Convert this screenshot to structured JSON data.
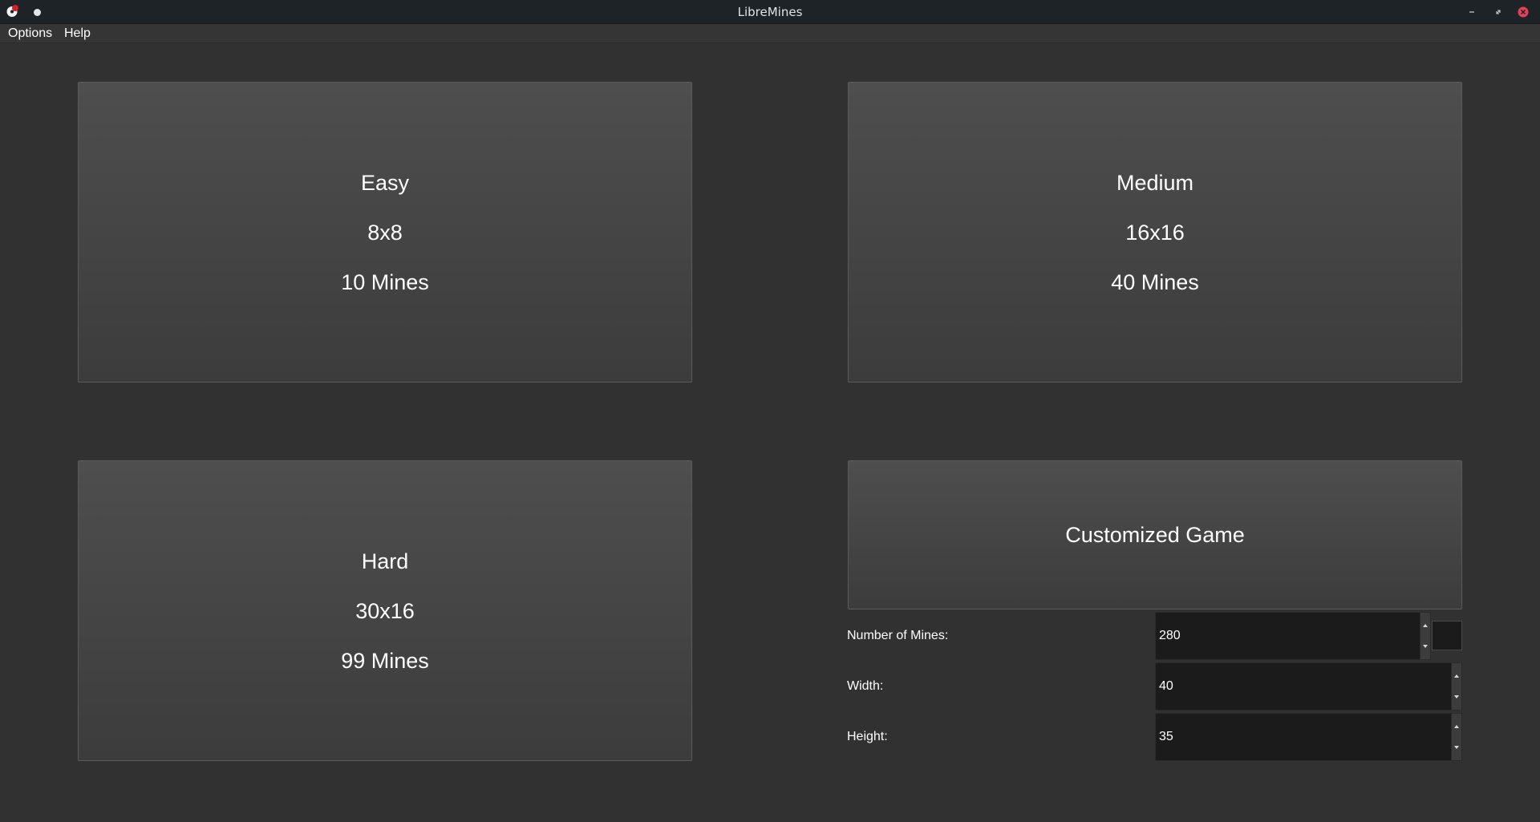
{
  "window": {
    "title": "LibreMines"
  },
  "menu": {
    "options": "Options",
    "help": "Help"
  },
  "difficulties": {
    "easy": {
      "name": "Easy",
      "size": "8x8",
      "mines": "10 Mines"
    },
    "medium": {
      "name": "Medium",
      "size": "16x16",
      "mines": "40 Mines"
    },
    "hard": {
      "name": "Hard",
      "size": "30x16",
      "mines": "99 Mines"
    }
  },
  "custom": {
    "button_label": "Customized Game",
    "mines_label": "Number of Mines:",
    "mines_value": "280",
    "width_label": "Width:",
    "width_value": "40",
    "height_label": "Height:",
    "height_value": "35"
  },
  "colors": {
    "background": "#313131",
    "titlebar": "#1d2326",
    "close_button": "#e4405a"
  },
  "icons": {
    "app": "libremines-logo-icon",
    "pin": "keep-above-icon",
    "minimize": "minimize-icon",
    "maximize": "maximize-icon",
    "close": "close-icon"
  }
}
